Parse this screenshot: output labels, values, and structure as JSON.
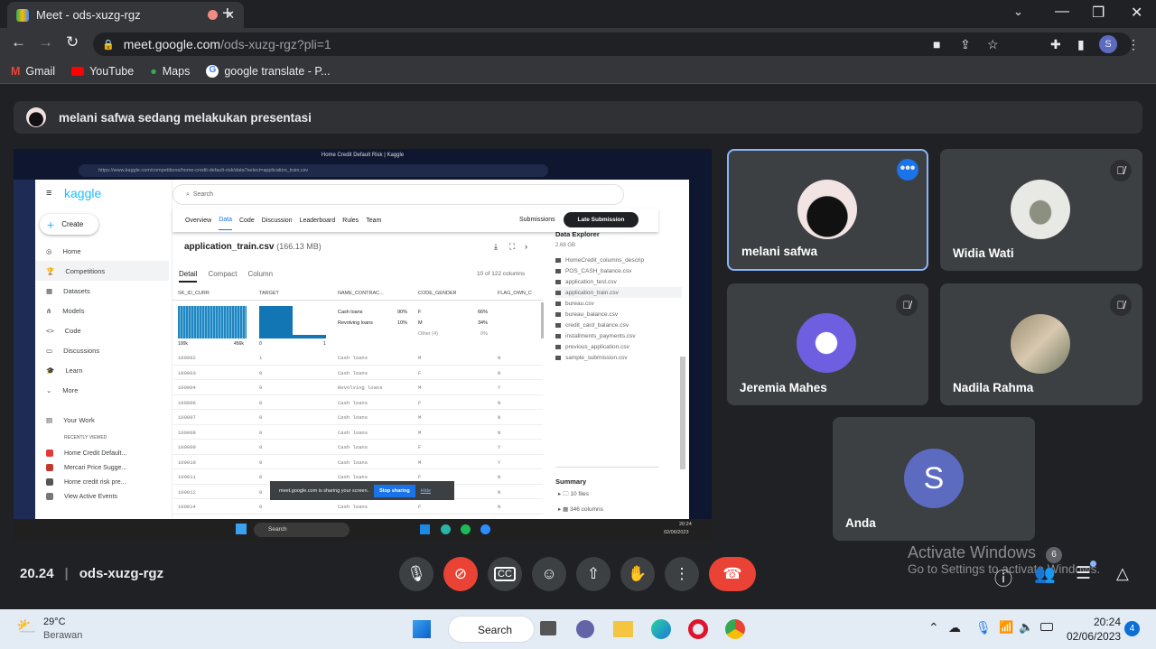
{
  "browser": {
    "tab_title": "Meet - ods-xuzg-rgz",
    "url_host": "meet.google.com",
    "url_path": "/ods-xuzg-rgz?pli=1",
    "profile_initial": "S",
    "bookmarks": [
      "Gmail",
      "YouTube",
      "Maps",
      "google translate - P..."
    ]
  },
  "meet": {
    "presenting_banner": "melani safwa sedang melakukan presentasi",
    "time": "20.24",
    "meeting_code": "ods-xuzg-rgz",
    "participant_count": "6",
    "accent": "#8ab4f8",
    "end_call_color": "#ea4335",
    "participants": [
      {
        "name": "melani safwa",
        "muted": false
      },
      {
        "name": "Widia Wati",
        "muted": true
      },
      {
        "name": "Jeremia Mahes",
        "muted": true
      },
      {
        "name": "Nadila Rahma",
        "muted": true
      },
      {
        "name": "Anda",
        "initial": "S",
        "muted": false
      }
    ],
    "watermark_title": "Activate Windows",
    "watermark_sub": "Go to Settings to activate Windows."
  },
  "shared": {
    "window_title": "Home Credit Default Risk | Kaggle",
    "url": "https://www.kaggle.com/competitions/home-credit-default-risk/data?select=application_train.csv",
    "logo": "kaggle",
    "create": "Create",
    "search_placeholder": "Search",
    "nav": [
      "Home",
      "Competitions",
      "Datasets",
      "Models",
      "Code",
      "Discussions",
      "Learn",
      "More"
    ],
    "your_work": "Your Work",
    "recently_viewed": "RECENTLY VIEWED",
    "recent": [
      "Home Credit Default...",
      "Mercari Price Sugge...",
      "Home credit risk pre...",
      "View Active Events"
    ],
    "tabs": [
      "Overview",
      "Data",
      "Code",
      "Discussion",
      "Leaderboard",
      "Rules",
      "Team"
    ],
    "submissions": "Submissions",
    "late_submission": "Late Submission",
    "file_name": "application_train.csv",
    "file_size": "(166.13 MB)",
    "view_tabs": [
      "Detail",
      "Compact",
      "Column"
    ],
    "columns_count": "10 of 122 columns",
    "headers": [
      "SK_ID_CURR",
      "TARGET",
      "NAME_CONTRAC...",
      "CODE_GENDER",
      "FLAG_OWN_C"
    ],
    "hist_sk": {
      "min": "100k",
      "max": "456k"
    },
    "hist_target": {
      "min": "0",
      "max": "1"
    },
    "contract_stats": [
      {
        "label": "Cash loans",
        "pct": "90%"
      },
      {
        "label": "Revolving loans",
        "pct": "10%"
      }
    ],
    "gender_stats": [
      {
        "label": "F",
        "pct": "66%"
      },
      {
        "label": "M",
        "pct": "34%"
      },
      {
        "label": "Other (4)",
        "pct": "0%"
      }
    ],
    "rows": [
      [
        "100002",
        "1",
        "Cash loans",
        "M",
        "N"
      ],
      [
        "100003",
        "0",
        "Cash loans",
        "F",
        "N"
      ],
      [
        "100004",
        "0",
        "Revolving loans",
        "M",
        "Y"
      ],
      [
        "100006",
        "0",
        "Cash loans",
        "F",
        "N"
      ],
      [
        "100007",
        "0",
        "Cash loans",
        "M",
        "N"
      ],
      [
        "100008",
        "0",
        "Cash loans",
        "M",
        "N"
      ],
      [
        "100009",
        "0",
        "Cash loans",
        "F",
        "Y"
      ],
      [
        "100010",
        "0",
        "Cash loans",
        "M",
        "Y"
      ],
      [
        "100011",
        "0",
        "Cash loans",
        "F",
        "N"
      ],
      [
        "100012",
        "0",
        "Cash loans",
        "F",
        "N"
      ],
      [
        "100014",
        "0",
        "Cash loans",
        "F",
        "N"
      ]
    ],
    "explorer_title": "Data Explorer",
    "explorer_size": "2.68 GB",
    "files": [
      "HomeCredit_columns_descrip",
      "POS_CASH_balance.csv",
      "application_test.csv",
      "application_train.csv",
      "bureau.csv",
      "bureau_balance.csv",
      "credit_card_balance.csv",
      "installments_payments.csv",
      "previous_application.csv",
      "sample_submission.csv"
    ],
    "summary_title": "Summary",
    "summary_files": "10 files",
    "summary_columns": "346 columns",
    "share_toast": "meet.google.com is sharing your screen.",
    "stop_sharing": "Stop sharing",
    "hide": "Hide",
    "taskbar_search": "Search",
    "clock_time": "20:24",
    "clock_date": "02/06/2023"
  },
  "taskbar": {
    "weather_temp": "29°C",
    "weather_desc": "Berawan",
    "search": "Search",
    "time": "20:24",
    "date": "02/06/2023",
    "notifications": "4"
  }
}
